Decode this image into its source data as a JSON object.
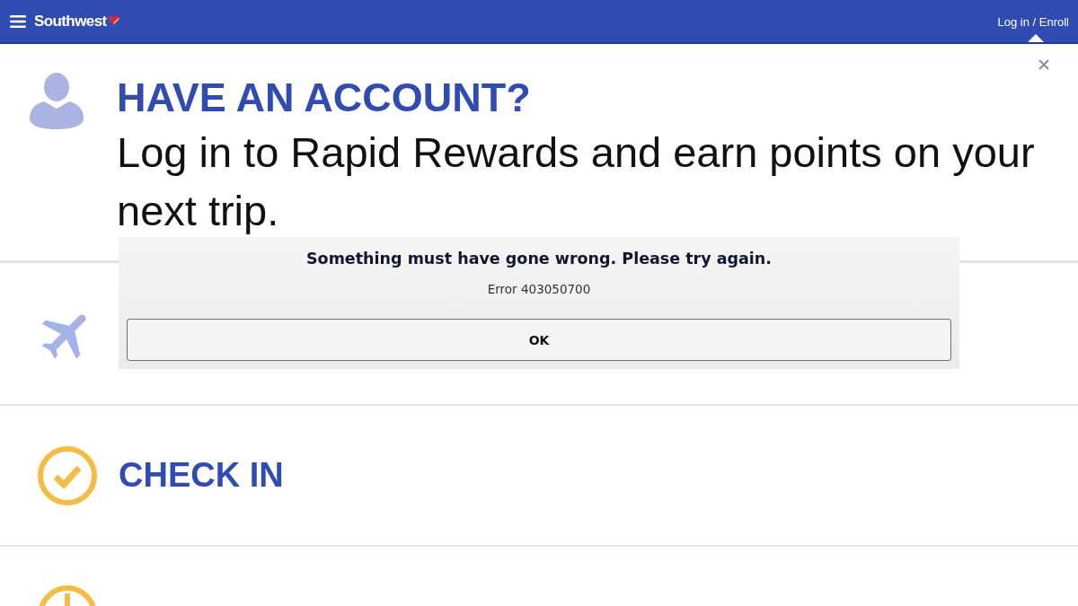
{
  "header": {
    "brand": "Southwest",
    "login_link": "Log in / Enroll"
  },
  "account_prompt": {
    "heading": "HAVE AN ACCOUNT?",
    "text": "Log in to Rapid Rewards and earn points on your next trip."
  },
  "menu_rows": [
    {
      "kind": "plane"
    },
    {
      "kind": "checkmark",
      "label": "CHECK IN"
    },
    {
      "kind": "clock"
    }
  ],
  "error_dialog": {
    "message": "Something must have gone wrong. Please try again.",
    "code": "Error 403050700",
    "button": "OK"
  }
}
